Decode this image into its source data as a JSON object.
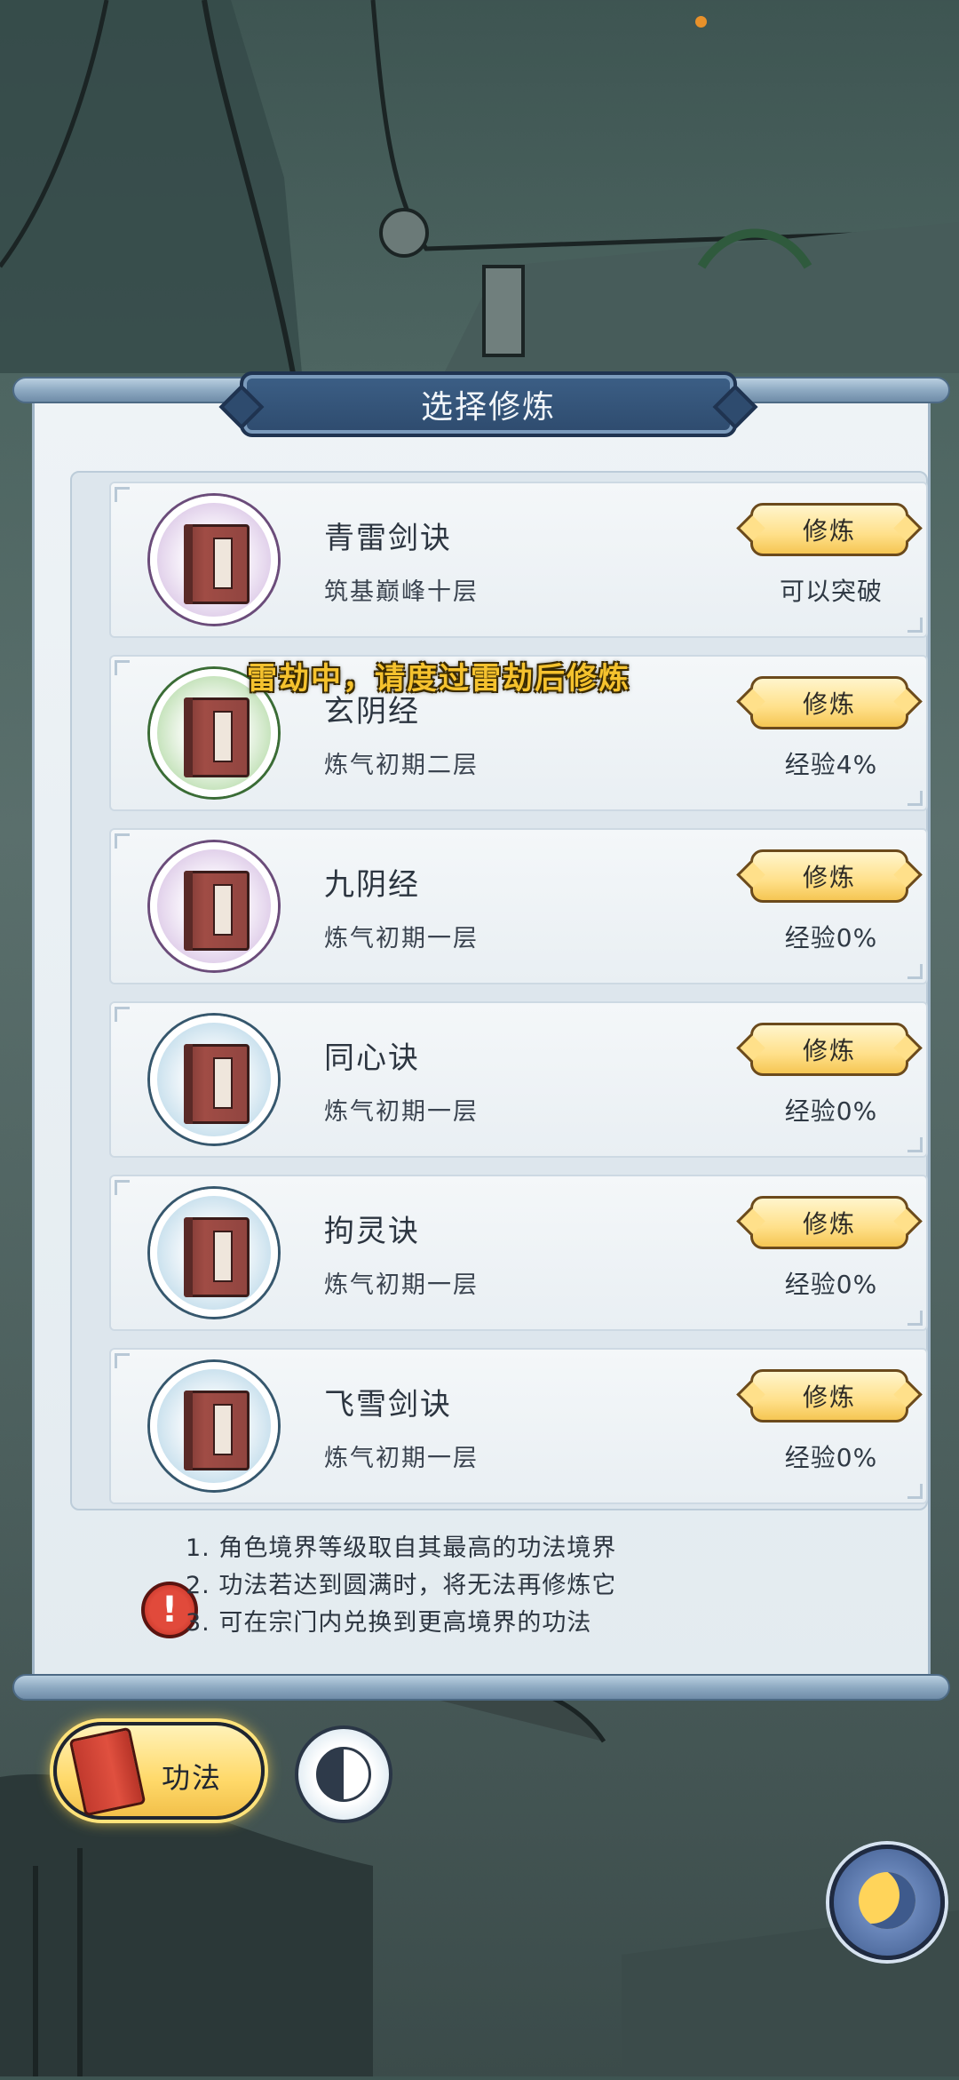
{
  "colors": {
    "panel_bg": "#e3ebf0",
    "title_plate": "#2e4b6e",
    "button_gold": "#ffe08a",
    "toast_yellow": "#f5c22e",
    "warn_red": "#e14a3b"
  },
  "panel": {
    "title": "选择修炼"
  },
  "toast": "雷劫中，请度过雷劫后修炼",
  "skills": [
    {
      "name": "青雷剑诀",
      "level": "筑基巅峰十层",
      "button": "修炼",
      "status": "可以突破",
      "medallion": "purple"
    },
    {
      "name": "玄阴经",
      "level": "炼气初期二层",
      "button": "修炼",
      "status": "经验4%",
      "medallion": "green"
    },
    {
      "name": "九阴经",
      "level": "炼气初期一层",
      "button": "修炼",
      "status": "经验0%",
      "medallion": "purple"
    },
    {
      "name": "同心诀",
      "level": "炼气初期一层",
      "button": "修炼",
      "status": "经验0%",
      "medallion": "blue"
    },
    {
      "name": "拘灵诀",
      "level": "炼气初期一层",
      "button": "修炼",
      "status": "经验0%",
      "medallion": "blue"
    },
    {
      "name": "飞雪剑诀",
      "level": "炼气初期一层",
      "button": "修炼",
      "status": "经验0%",
      "medallion": "blue"
    }
  ],
  "notes": [
    "1. 角色境界等级取自其最高的功法境界",
    "2. 功法若达到圆满时，将无法再修炼它",
    "3. 可在宗门内兑换到更高境界的功法"
  ],
  "warning_icon": "exclamation-icon",
  "bottom": {
    "gongfa_label": "功法",
    "gongfa_icon": "book-icon",
    "yinyang_icon": "yin-yang-icon",
    "moon_icon": "crescent-moon-icon"
  }
}
